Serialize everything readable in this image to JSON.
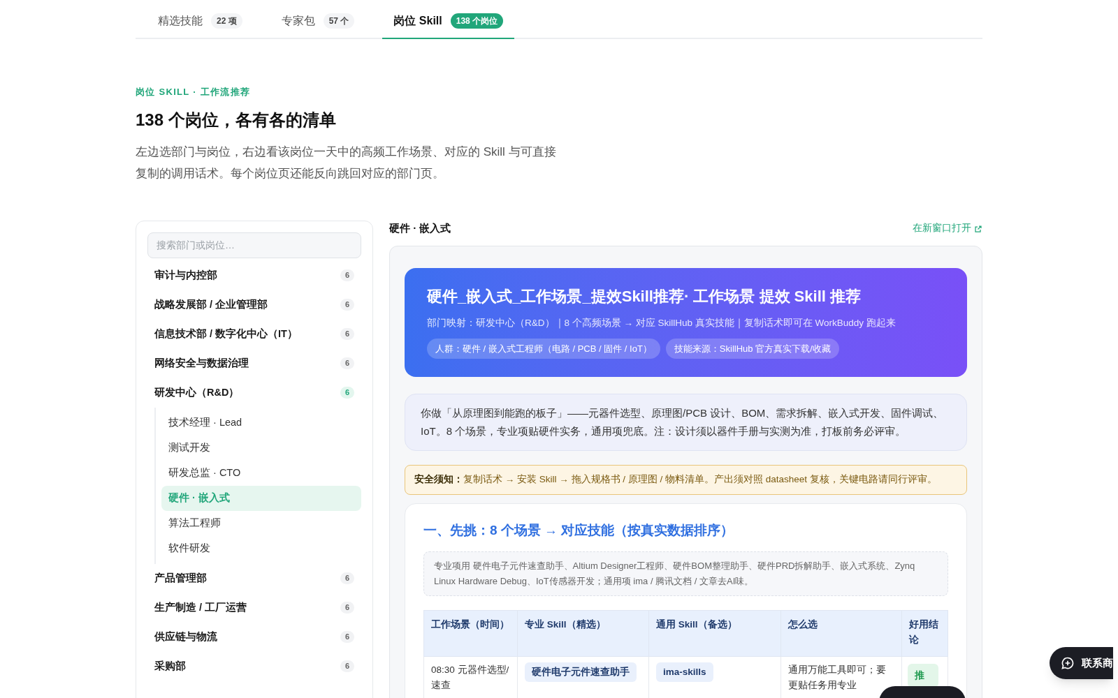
{
  "tabs": [
    {
      "label": "精选技能",
      "count": "22 项",
      "selected": false
    },
    {
      "label": "专家包",
      "count": "57 个",
      "selected": false
    },
    {
      "label": "岗位 Skill",
      "count": "138 个岗位",
      "selected": true
    }
  ],
  "intro": {
    "eyebrow": "岗位 SKILL · 工作流推荐",
    "title": "138 个岗位，各有各的清单",
    "description": "左边选部门与岗位，右边看该岗位一天中的高频工作场景、对应的 Skill 与可直接复制的调用话术。每个岗位页还能反向跳回对应的部门页。"
  },
  "sidebar": {
    "search": {
      "placeholder": "搜索部门或岗位…"
    },
    "departments": [
      {
        "name": "审计与内控部",
        "count": "6",
        "expanded": false
      },
      {
        "name": "战略发展部 / 企业管理部",
        "count": "6",
        "expanded": false
      },
      {
        "name": "信息技术部 / 数字化中心（IT）",
        "count": "6",
        "expanded": false
      },
      {
        "name": "网络安全与数据治理",
        "count": "6",
        "expanded": false
      },
      {
        "name": "研发中心（R&D）",
        "count": "6",
        "expanded": true,
        "children": [
          {
            "name": "技术经理 · Lead",
            "selected": false
          },
          {
            "name": "测试开发",
            "selected": false
          },
          {
            "name": "研发总监 · CTO",
            "selected": false
          },
          {
            "name": "硬件 · 嵌入式",
            "selected": true
          },
          {
            "name": "算法工程师",
            "selected": false
          },
          {
            "name": "软件研发",
            "selected": false
          }
        ]
      },
      {
        "name": "产品管理部",
        "count": "6",
        "expanded": false
      },
      {
        "name": "生产制造 / 工厂运营",
        "count": "6",
        "expanded": false
      },
      {
        "name": "供应链与物流",
        "count": "6",
        "expanded": false
      },
      {
        "name": "采购部",
        "count": "6",
        "expanded": false
      }
    ]
  },
  "detail": {
    "title": "硬件 · 嵌入式",
    "open_link": "在新窗口打开",
    "hero": {
      "title": "硬件_嵌入式_工作场景_提效Skill推荐· 工作场景 提效 Skill 推荐",
      "meta": "部门映射：研发中心（R&D）｜8 个高频场景 → 对应 SkillHub 真实技能｜复制话术即可在 WorkBuddy 跑起来",
      "tags": [
        "人群：硬件 / 嵌入式工程师（电路 / PCB / 固件 / IoT）",
        "技能来源：SkillHub 官方真实下载/收藏"
      ]
    },
    "summary": "你做「从原理图到能跑的板子」——元器件选型、原理图/PCB 设计、BOM、需求拆解、嵌入式开发、固件调试、IoT。8 个场景，专业项贴硬件实务，通用项兜底。注：设计须以器件手册与实测为准，打板前务必评审。",
    "notice": {
      "label": "安全须知：",
      "text": "复制话术 → 安装 Skill → 拖入规格书 / 原理图 / 物料清单。产出须对照 datasheet 复核，关键电路请同行评审。"
    },
    "section": {
      "title": "一、先挑：8 个场景 → 对应技能（按真实数据排序）",
      "note": "专业项用 硬件电子元件速查助手、Altium Designer工程师、硬件BOM整理助手、硬件PRD拆解助手、嵌入式系统、Zynq Linux Hardware Debug、IoT传感器开发；通用项 ima / 腾讯文档 / 文章去AI味。",
      "table": {
        "columns": [
          "工作场景（时间）",
          "专业 Skill（精选）",
          "通用 Skill（备选）",
          "怎么选",
          "好用结论"
        ],
        "rows": [
          {
            "scenario": "08:30 元器件选型/速查",
            "pro_skill": "硬件电子元件速查助手",
            "general_skill": "ima-skills",
            "how": "通用万能工具即可；要更贴任务用专业",
            "verdict": "推"
          }
        ]
      }
    }
  },
  "floating": {
    "contact": "联系商"
  }
}
